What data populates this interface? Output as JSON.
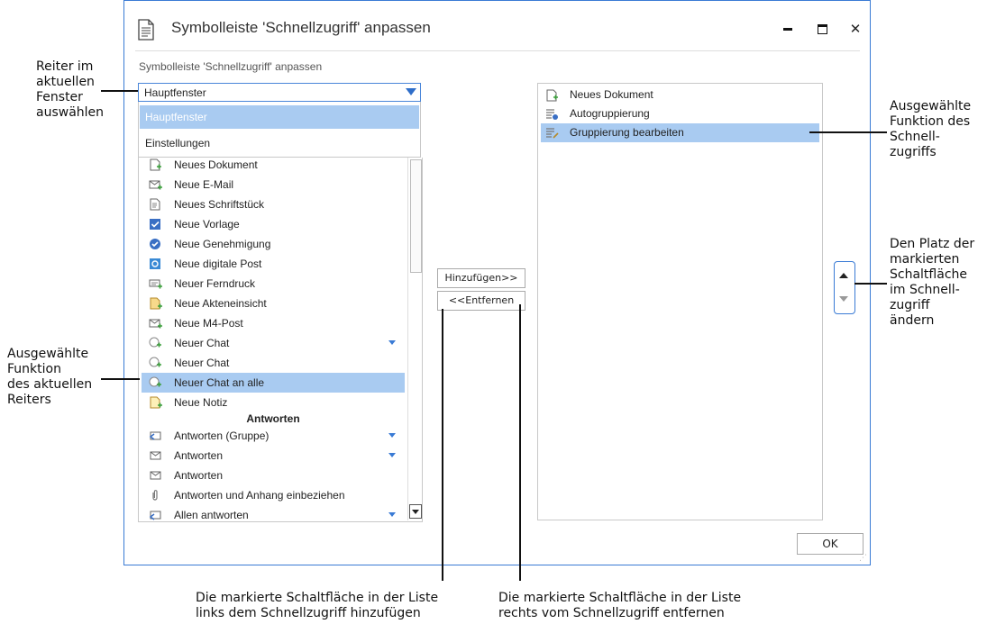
{
  "dialog": {
    "title": "Symbolleiste 'Schnellzugriff' anpassen",
    "subtitle": "Symbolleiste 'Schnellzugriff' anpassen",
    "minimize": "‒",
    "maximize": "■",
    "close": "✕"
  },
  "combo": {
    "value": "Hauptfenster",
    "options": [
      "Hauptfenster",
      "Einstellungen"
    ]
  },
  "left_list": {
    "items": [
      {
        "label": "Neues Dokument",
        "icon": "new-document-icon"
      },
      {
        "label": "Neue E-Mail",
        "icon": "new-email-icon"
      },
      {
        "label": "Neues Schriftstück",
        "icon": "new-writing-icon"
      },
      {
        "label": "Neue Vorlage",
        "icon": "new-template-icon"
      },
      {
        "label": "Neue Genehmigung",
        "icon": "new-approval-icon"
      },
      {
        "label": "Neue digitale Post",
        "icon": "new-digital-mail-icon"
      },
      {
        "label": "Neuer Ferndruck",
        "icon": "new-remote-print-icon"
      },
      {
        "label": "Neue Akteneinsicht",
        "icon": "new-file-inspection-icon"
      },
      {
        "label": "Neue M4-Post",
        "icon": "new-m4-mail-icon"
      },
      {
        "label": "Neuer Chat",
        "icon": "new-chat-icon"
      },
      {
        "label": "Neuer Chat",
        "icon": "new-chat-icon"
      },
      {
        "label": "Neuer Chat an alle",
        "icon": "new-chat-all-icon"
      },
      {
        "label": "Neue Notiz",
        "icon": "new-note-icon"
      }
    ],
    "group_heading": "Antworten",
    "group_items": [
      {
        "label": "Antworten (Gruppe)",
        "icon": "reply-group-icon"
      },
      {
        "label": "Antworten",
        "icon": "reply-icon"
      },
      {
        "label": "Antworten",
        "icon": "reply-icon"
      },
      {
        "label": "Antworten und Anhang einbeziehen",
        "icon": "reply-attachment-icon"
      },
      {
        "label": "Allen antworten",
        "icon": "reply-all-icon"
      }
    ]
  },
  "buttons": {
    "add": "Hinzufügen>>",
    "remove": "<<Entfernen",
    "ok": "OK"
  },
  "right_list": {
    "items": [
      {
        "label": "Neues Dokument",
        "icon": "new-document-icon"
      },
      {
        "label": "Autogruppierung",
        "icon": "autogroup-icon"
      },
      {
        "label": "Gruppierung bearbeiten",
        "icon": "edit-grouping-icon"
      }
    ]
  },
  "annotations": {
    "reiter": "Reiter im\naktuellen\nFenster\nauswählen",
    "funktion_reiter": "Ausgewählte\nFunktion\ndes aktuellen\nReiters",
    "funktion_schnell": "Ausgewählte\nFunktion des\nSchnell-\nzugriffs",
    "platz": "Den Platz der\nmarkierten\nSchaltfläche\nim Schnell-\nzugriff\nändern",
    "hinzufuegen": "Die markierte Schaltfläche in der Liste\nlinks dem Schnellzugriff hinzufügen",
    "entfernen": "Die markierte Schaltfläche in der Liste\nrechts vom Schnellzugriff entfernen"
  },
  "colors": {
    "accent": "#3a7bd5",
    "selection": "#a9cbf1"
  }
}
